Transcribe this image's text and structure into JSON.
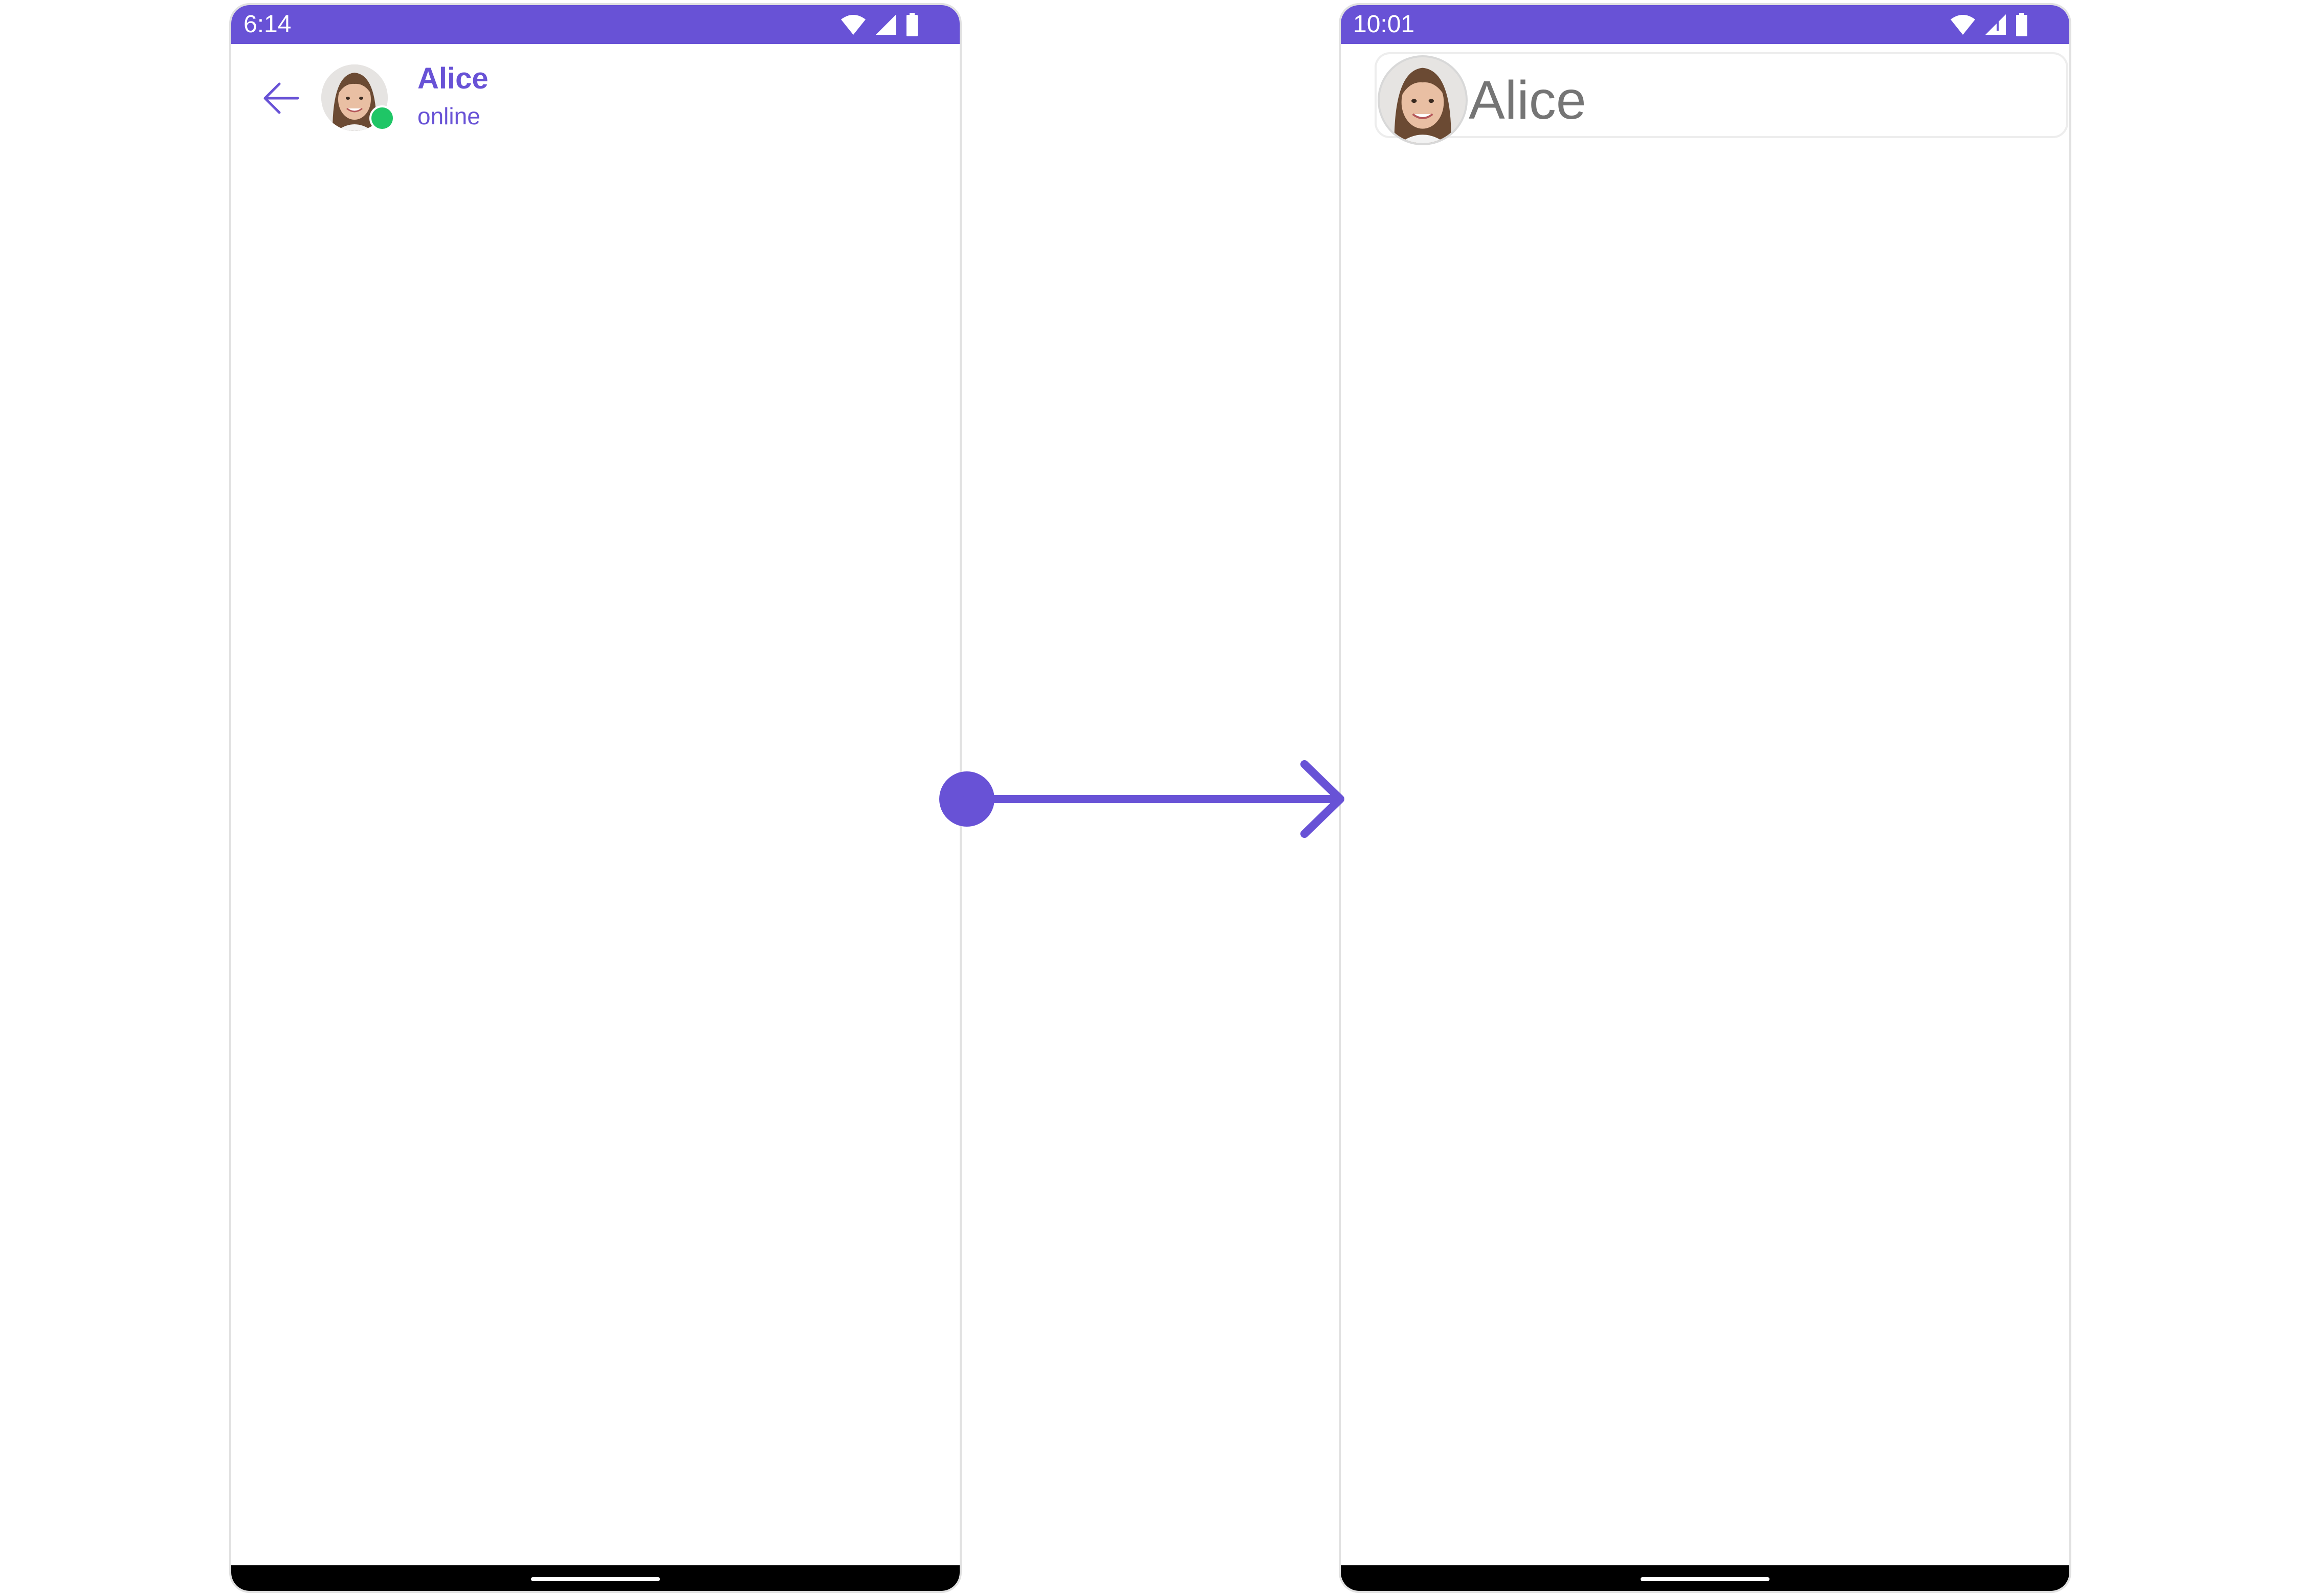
{
  "colors": {
    "accent": "#6852d6",
    "online": "#1fc666",
    "status_bar": "#6852d6",
    "nav_bar": "#000000",
    "phone_border": "#e1e1e1",
    "name_grey": "#757575"
  },
  "left_screen": {
    "status_bar": {
      "time": "6:14",
      "icons": [
        "wifi-icon",
        "signal-icon",
        "battery-icon"
      ]
    },
    "header": {
      "back_icon": "arrow-left-icon",
      "avatar": "user-avatar-photo",
      "presence": "online-status-dot",
      "name": "Alice",
      "status": "online"
    }
  },
  "right_screen": {
    "status_bar": {
      "time": "10:01",
      "icons": [
        "wifi-icon",
        "signal-icon",
        "battery-icon"
      ]
    },
    "header": {
      "avatar": "user-avatar-photo",
      "name": "Alice"
    }
  },
  "connector": {
    "start": "dot",
    "end": "arrowhead",
    "direction": "left-to-right"
  }
}
